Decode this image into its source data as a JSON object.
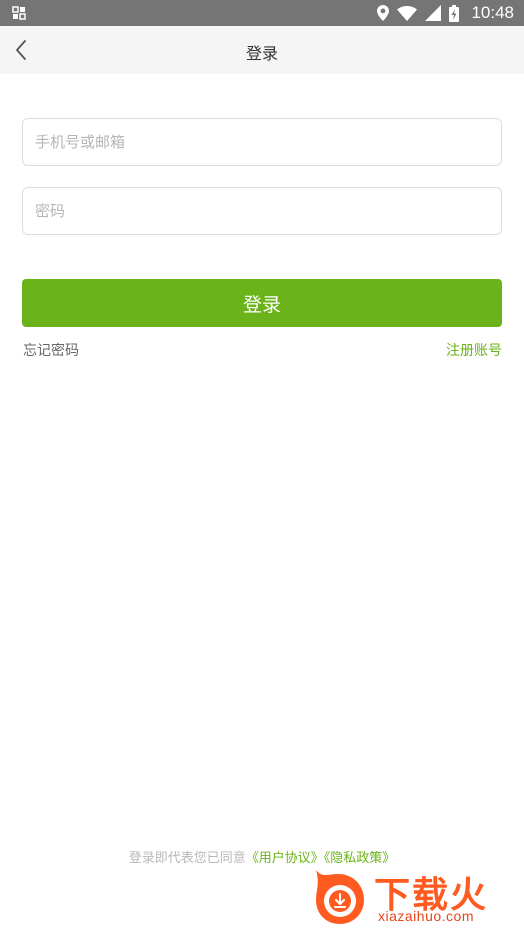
{
  "status_bar": {
    "time": "10:48",
    "icons": [
      "notification-icon",
      "location-icon",
      "wifi-icon",
      "signal-icon",
      "battery-icon"
    ]
  },
  "app_bar": {
    "title": "登录",
    "back_icon": "chevron-left-icon"
  },
  "form": {
    "phone_placeholder": "手机号或邮箱",
    "phone_value": "",
    "password_placeholder": "密码",
    "password_value": "",
    "login_label": "登录",
    "forgot_label": "忘记密码",
    "register_label": "注册账号"
  },
  "agreement": {
    "prefix": "登录即代表您已同意",
    "user_agreement": "《用户协议》",
    "privacy_policy": "《隐私政策》"
  },
  "watermark": {
    "brand": "下载火",
    "url": "xiazaihuo.com"
  },
  "colors": {
    "accent": "#6ab31a",
    "status_bar": "#757575",
    "app_bar": "#f5f5f5"
  }
}
